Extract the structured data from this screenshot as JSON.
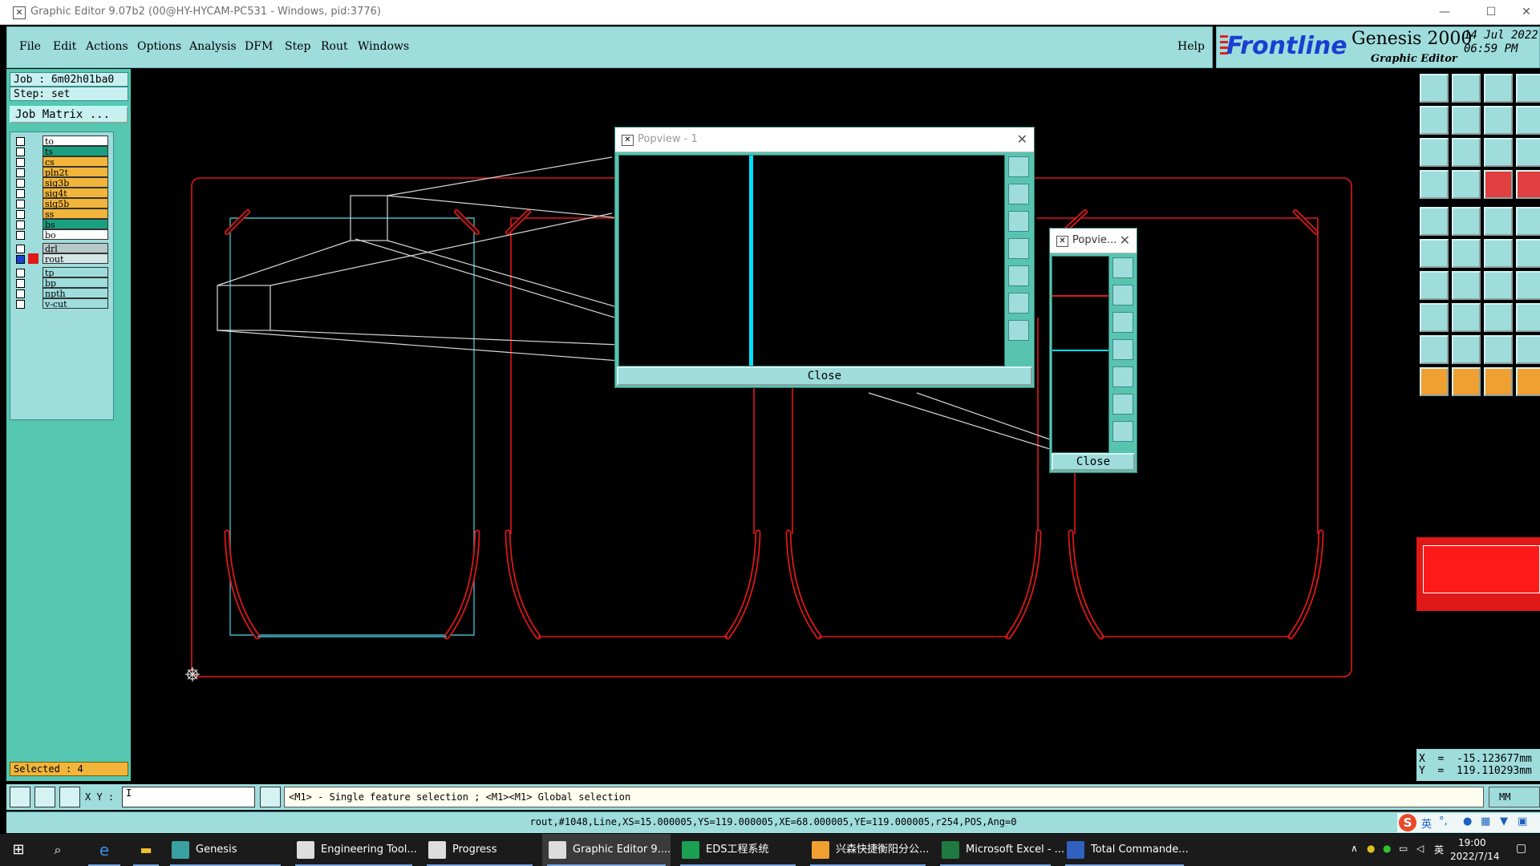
{
  "window": {
    "title": "Graphic Editor 9.07b2 (00@HY-HYCAM-PC531 - Windows, pid:3776)",
    "minimize": "—",
    "maximize": "☐",
    "close": "✕"
  },
  "menubar": {
    "items": [
      "File",
      "Edit",
      "Actions",
      "Options",
      "Analysis",
      "DFM",
      "Step",
      "Rout",
      "Windows"
    ],
    "help": "Help"
  },
  "logo": {
    "brand": "Frontline",
    "product": "Genesis 2000",
    "subtitle": "Graphic Editor",
    "date": "14 Jul 2022",
    "time": "06:59 PM"
  },
  "job": {
    "job_line": "Job  :  6m02h01ba0",
    "step_line": "Step:  set",
    "matrix_button": "Job Matrix ..."
  },
  "layers": [
    {
      "name": "to",
      "color": "#ffffff"
    },
    {
      "name": "ts",
      "color": "#1aa080"
    },
    {
      "name": "cs",
      "color": "#f0b53a"
    },
    {
      "name": "pln2t",
      "color": "#f0b53a"
    },
    {
      "name": "sig3b",
      "color": "#f0b53a"
    },
    {
      "name": "sig4t",
      "color": "#f0b53a"
    },
    {
      "name": "sig5b",
      "color": "#f0b53a"
    },
    {
      "name": "ss",
      "color": "#f0b53a"
    },
    {
      "name": "bs",
      "color": "#1aa080"
    },
    {
      "name": "bo",
      "color": "#ffffff"
    },
    {
      "name": "drl",
      "color": "#b8c8c8"
    },
    {
      "name": "rout",
      "color": "#d6e6e6"
    },
    {
      "name": "tp",
      "color": "#9fdcdc"
    },
    {
      "name": "bp",
      "color": "#9fdcdc"
    },
    {
      "name": "npth",
      "color": "#9fdcdc"
    },
    {
      "name": "v-cut",
      "color": "#9fdcdc"
    }
  ],
  "selected": "Selected : 4",
  "popview1": {
    "title": "Popview - 1",
    "close": "Close"
  },
  "popview2": {
    "title": "Popvie...",
    "close": "Close"
  },
  "coords": {
    "x": "X  =  -15.123677mm",
    "y": "Y  =  119.110293mm"
  },
  "cmd": {
    "xy_label": "X Y :",
    "xy_value": "I",
    "message": "<M1> - Single feature selection ; <M1><M1> Global selection",
    "unit": "MM"
  },
  "info": "rout,#1048,Line,XS=15.000005,YS=119.000005,XE=68.000005,YE=119.000005,r254,POS,Ang=0",
  "ime": {
    "lang": "英",
    "mode": "°,"
  },
  "taskbar": {
    "items": [
      {
        "label": "Genesis",
        "color": "#3aa0a0"
      },
      {
        "label": "Engineering Tool...",
        "color": "#dddddd"
      },
      {
        "label": "Progress",
        "color": "#dddddd"
      },
      {
        "label": "Graphic Editor 9....",
        "color": "#dddddd"
      },
      {
        "label": "EDS工程系统",
        "color": "#1aa050"
      },
      {
        "label": "兴森快捷衡阳分公...",
        "color": "#f0a030"
      },
      {
        "label": "Microsoft Excel - ...",
        "color": "#1e7a40"
      },
      {
        "label": "Total Commande...",
        "color": "#3060c0"
      }
    ],
    "tray_lang": "英",
    "clock_time": "19:00",
    "clock_date": "2022/7/14"
  },
  "colors": {
    "panel_teal": "#9fdcdc",
    "panel_green": "#56c8b2",
    "rout_red": "#e01818",
    "profile_cyan": "#40b8c8",
    "highlight_cyan": "#00e0ff"
  }
}
